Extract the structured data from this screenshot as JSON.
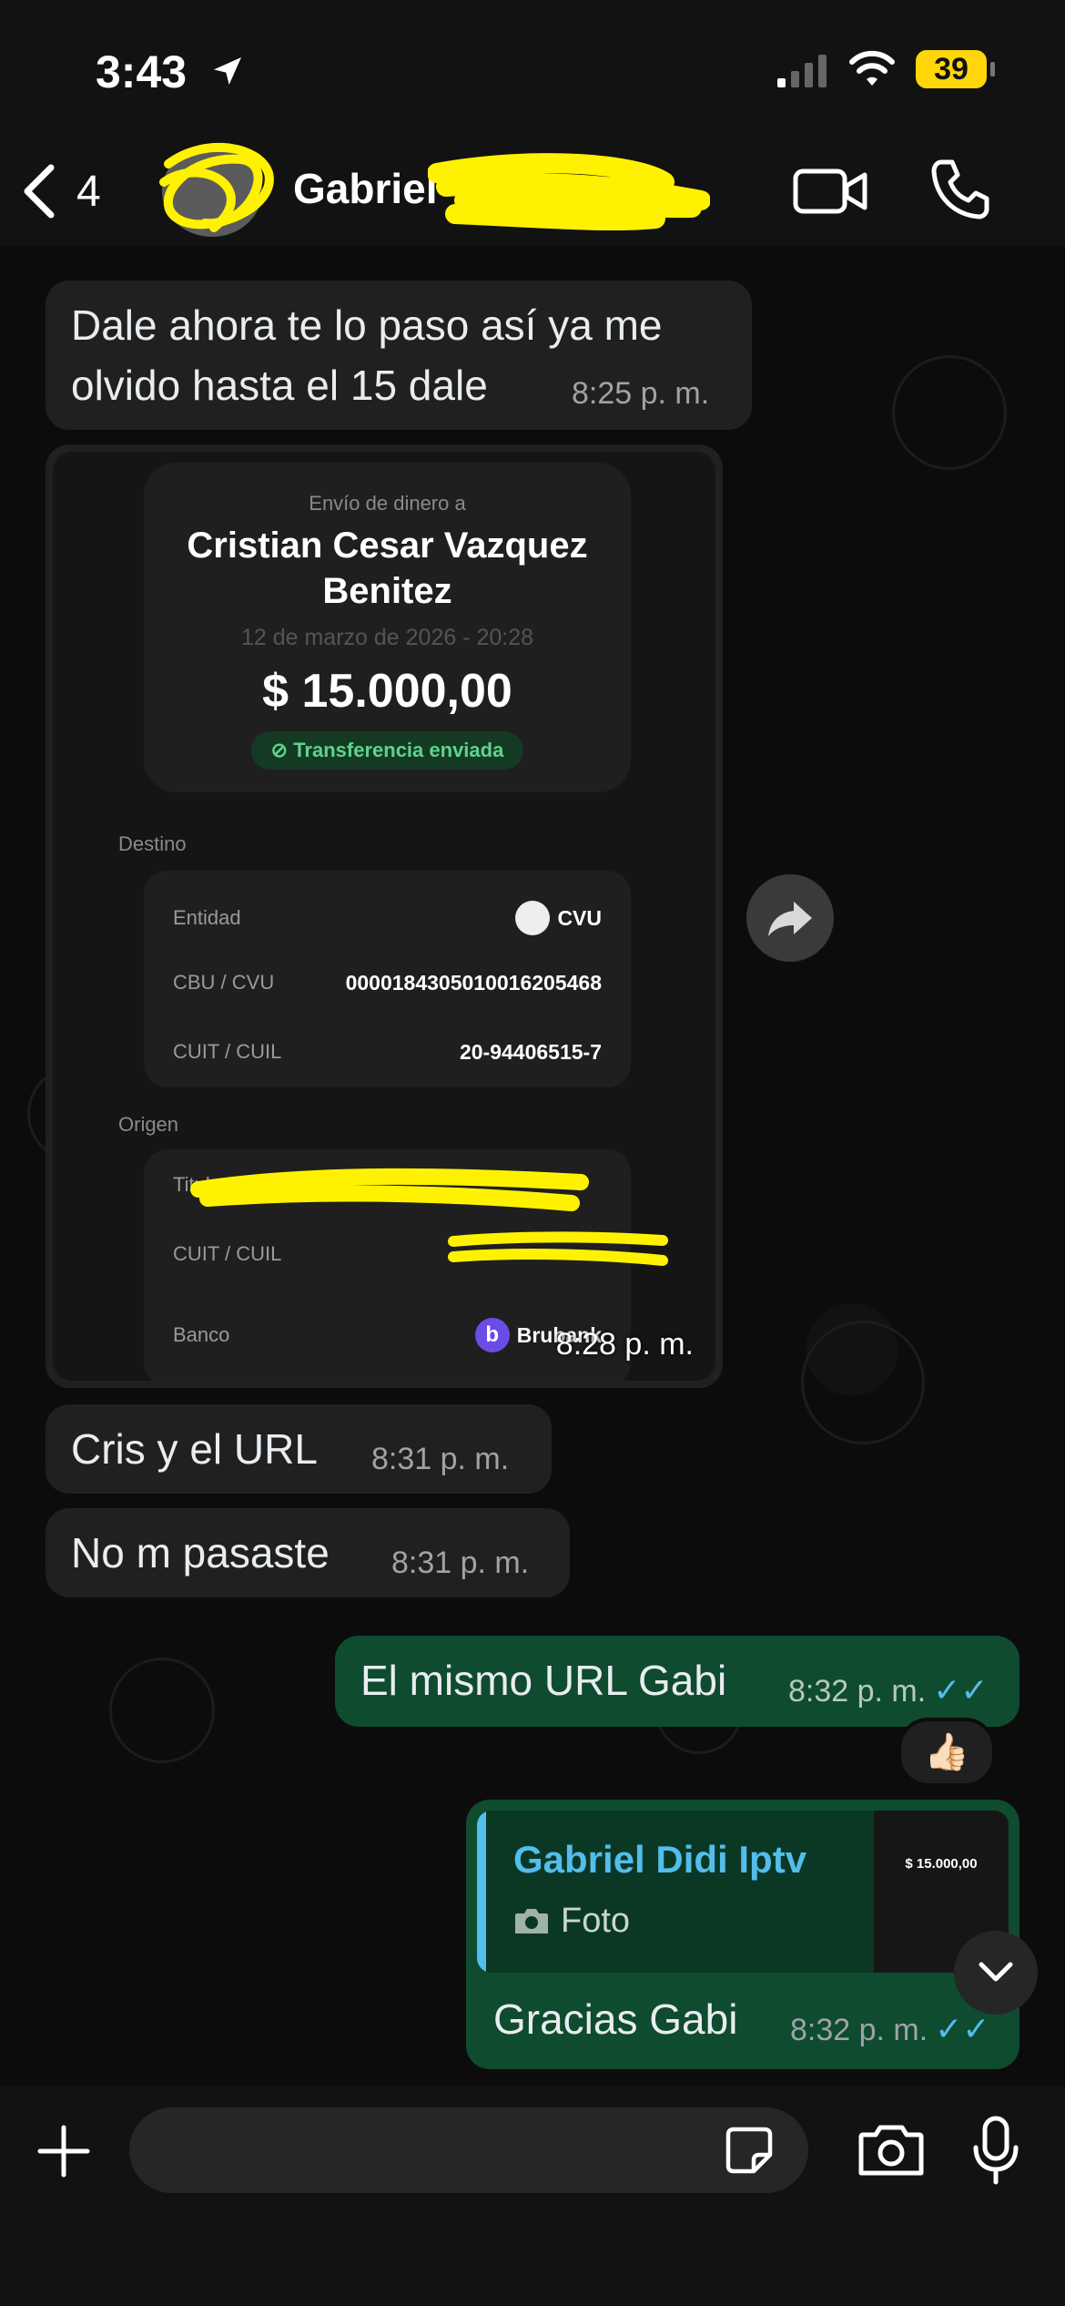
{
  "status_bar": {
    "time": "3:43",
    "battery": "39"
  },
  "header": {
    "back_count": "4",
    "contact_name": "Gabriel"
  },
  "messages": [
    {
      "text_line1": "Dale ahora te lo paso así ya me",
      "text_line2": "olvido hasta el 15 dale",
      "time": "8:25 p. m."
    },
    {
      "time": "8:28 p. m."
    },
    {
      "text": "Cris y el URL",
      "time": "8:31 p. m."
    },
    {
      "text": "No m pasaste",
      "time": "8:31 p. m."
    },
    {
      "text": "El mismo URL Gabi",
      "time": "8:32 p. m.",
      "ticks": "✓✓",
      "reaction": "👍🏻"
    },
    {
      "text": "Gracias Gabi",
      "time": "8:32 p. m.",
      "ticks": "✓✓"
    }
  ],
  "receipt": {
    "heading": "Envío de dinero a",
    "recipient_line1": "Cristian Cesar Vazquez",
    "recipient_line2": "Benitez",
    "date": "12 de marzo de 2026 - 20:28",
    "amount": "$ 15.000,00",
    "status": "Transferencia enviada",
    "destino_label": "Destino",
    "entidad_label": "Entidad",
    "entidad_value": "CVU",
    "cbu_label": "CBU / CVU",
    "cbu_value": "0000184305010016205468",
    "cuit_label": "CUIT / CUIL",
    "cuit_value": "20-94406515-7",
    "origen_label": "Origen",
    "titular_label": "Titular",
    "origen_cuit_label": "CUIT / CUIL",
    "banco_label": "Banco",
    "banco_value": "Brubank"
  },
  "quote": {
    "author": "Gabriel Didi Iptv",
    "type": "Foto",
    "thumb_amount": "$ 15.000,00"
  },
  "composer": {
    "placeholder": ""
  },
  "colors": {
    "incoming": "#202020",
    "outgoing": "#0f4b2f",
    "accent": "#53bdeb",
    "redaction": "#fff200"
  }
}
